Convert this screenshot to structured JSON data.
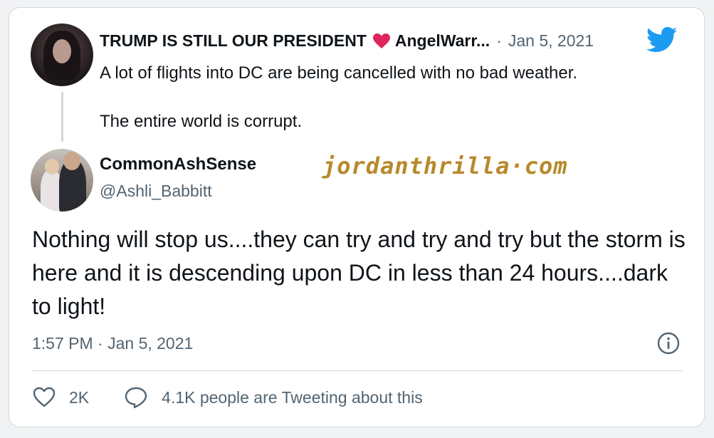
{
  "quoted_tweet": {
    "display_name": "TRUMP IS STILL OUR PRESIDENT",
    "handle_truncated": "AngelWarr...",
    "separator": "·",
    "date": "Jan 5, 2021",
    "text_line1": "A lot of flights into DC are being cancelled with no bad weather.",
    "text_line2": "The entire world is corrupt."
  },
  "tweet": {
    "display_name": "CommonAshSense",
    "handle": "@Ashli_Babbitt",
    "text": "Nothing will stop us....they can try and try and try but the storm is here and it is descending upon DC in less than 24 hours....dark to light!",
    "timestamp": "1:57 PM · Jan 5, 2021"
  },
  "watermark": "jordanthrilla·com",
  "actions": {
    "likes": "2K",
    "conversation": "4.1K people are Tweeting about this"
  },
  "colors": {
    "heart_emoji": "#e0245e",
    "twitter_blue": "#1d9bf0",
    "watermark": "#b8892b",
    "secondary_text": "#536471"
  },
  "icons": [
    "heart-emoji-icon",
    "twitter-bird-icon",
    "info-icon",
    "like-heart-icon",
    "reply-bubble-icon"
  ]
}
